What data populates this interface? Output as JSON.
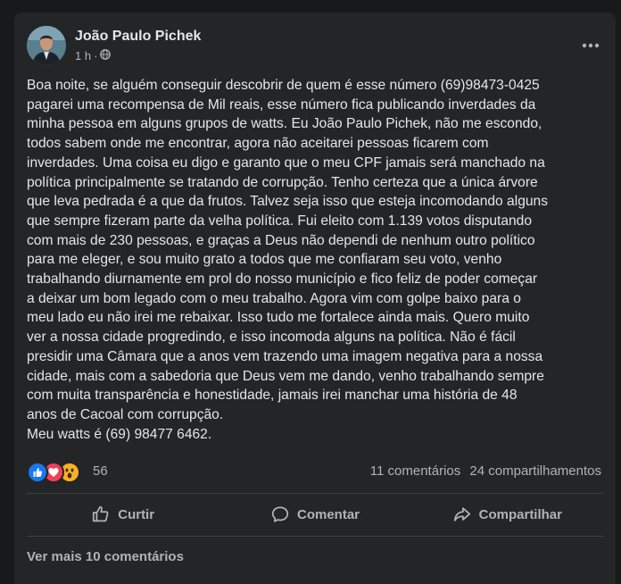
{
  "post": {
    "author": "João Paulo Pichek",
    "time": "1 h",
    "privacy_icon": "globe-icon",
    "text": "Boa noite, se alguém conseguir descobrir de quem é esse número (69)98473-0425\npagarei uma recompensa de Mil reais, esse número fica publicando inverdades da\nminha pessoa em alguns grupos de watts. Eu João Paulo Pichek, não me escondo,\ntodos sabem onde me encontrar, agora não aceitarei pessoas ficarem com\ninverdades. Uma coisa eu digo e garanto que o meu CPF jamais será manchado na\npolítica principalmente se tratando de corrupção. Tenho certeza que a única árvore\nque leva pedrada é a que da frutos. Talvez seja isso que esteja incomodando alguns\nque sempre fizeram parte da velha política. Fui eleito com 1.139 votos disputando\ncom mais de 230 pessoas, e graças a Deus não dependi de nenhum outro político\npara me eleger, e sou muito grato a todos que me confiaram seu voto, venho\ntrabalhando diurnamente em prol do nosso município e fico feliz de poder começar\na deixar um bom legado com o meu trabalho. Agora vim com golpe baixo para o\nmeu lado eu não irei me rebaixar. Isso tudo me fortalece ainda mais. Quero muito\nver a nossa cidade progredindo, e isso incomoda alguns na política. Não é fácil\npresidir uma Câmara que a anos vem trazendo uma imagem negativa para a nossa\ncidade, mais com a sabedoria que Deus vem me dando, venho trabalhando sempre\ncom muita transparência e honestidade, jamais irei manchar uma história de 48\nanos de Cacoal com corrupção.\nMeu watts é (69) 98477 6462."
  },
  "stats": {
    "reaction_icons": [
      "like-icon",
      "love-icon",
      "wow-icon"
    ],
    "reaction_count": "56",
    "comments": "11 comentários",
    "shares": "24 compartilhamentos"
  },
  "actions": {
    "like": "Curtir",
    "comment": "Comentar",
    "share": "Compartilhar"
  },
  "see_more_comments": "Ver mais 10 comentários",
  "colors": {
    "background": "#18191a",
    "card": "#242526",
    "text_primary": "#e4e6eb",
    "text_secondary": "#b0b3b8",
    "like_blue": "#1877f2",
    "love_red": "#f33e58",
    "wow_yellow": "#f7b125"
  }
}
